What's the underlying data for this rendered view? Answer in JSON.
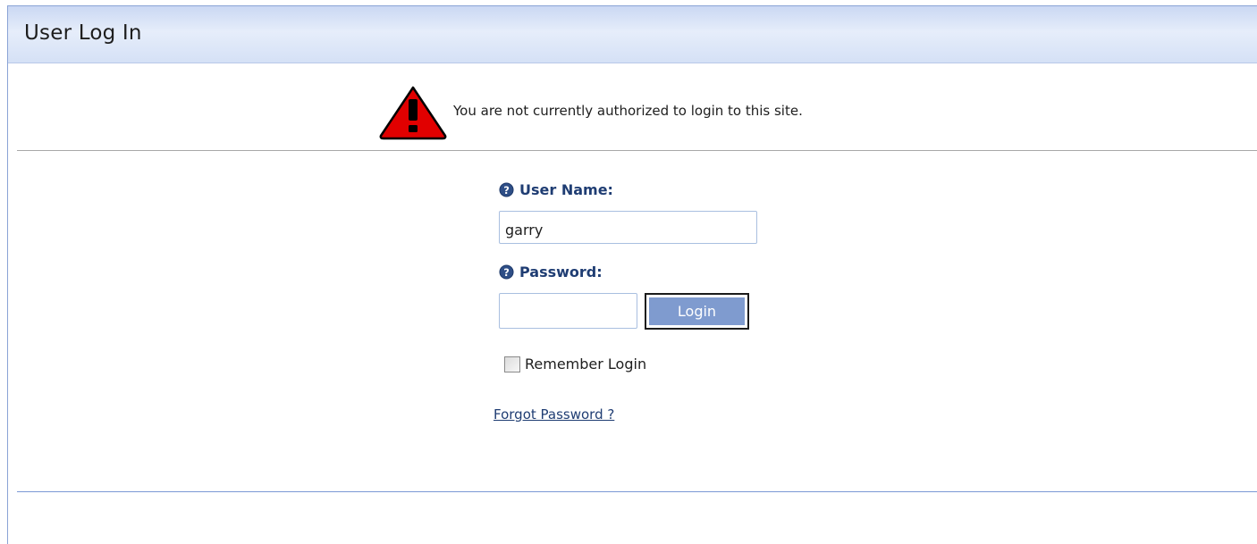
{
  "header": {
    "title": "User Log In"
  },
  "alert": {
    "message": "You are not currently authorized to login to this site.",
    "icon": "warning-icon",
    "color": "#e10000"
  },
  "form": {
    "username_label": "User Name:",
    "username_value": "garry",
    "password_label": "Password:",
    "password_value": "",
    "login_button": "Login",
    "remember_label": "Remember Login",
    "remember_checked": false,
    "forgot_link": "Forgot Password ?",
    "help_icon": "question-help-icon"
  },
  "colors": {
    "label": "#1f3d73",
    "button": "#7f9bcf",
    "header_gradient_top": "#cad8f3",
    "divider_blue": "#7b98d4"
  }
}
